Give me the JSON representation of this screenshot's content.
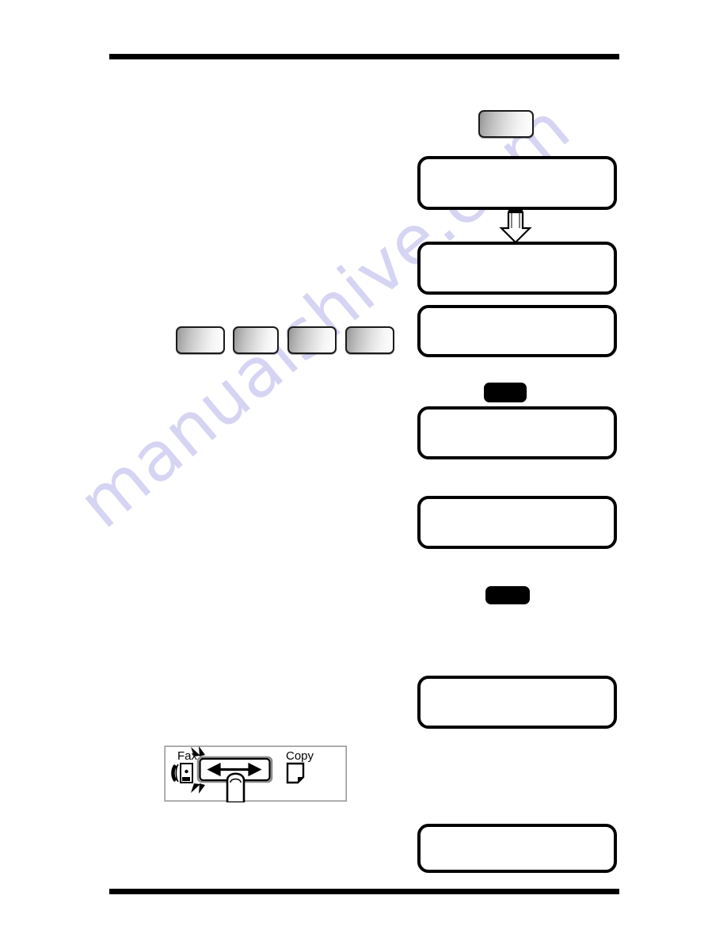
{
  "document": {
    "type": "scanned-manual-page",
    "page_background": "#ffffff",
    "rule_color": "#000000",
    "header_rule_visible": true,
    "footer_rule_visible": true,
    "header_text": "",
    "footer_text": "",
    "page_number": ""
  },
  "watermark": {
    "text": "manualshive.com",
    "color": "#c9c6ef",
    "rotation_deg": -40
  },
  "body_text": {
    "intro": "",
    "step_1": "",
    "step_2": "",
    "step_3": "",
    "step_4": "",
    "note": ""
  },
  "panel_buttons": {
    "top_right": {
      "label": "",
      "name": "function-button"
    },
    "row": [
      {
        "label": "",
        "name": "panel-button-1"
      },
      {
        "label": "",
        "name": "panel-button-2"
      },
      {
        "label": "",
        "name": "panel-button-3"
      },
      {
        "label": "",
        "name": "panel-button-4"
      }
    ]
  },
  "black_buttons": [
    {
      "label": "",
      "name": "start-button"
    },
    {
      "label": "",
      "name": "stop-button"
    }
  ],
  "lcd_displays": [
    {
      "name": "lcd-display-1",
      "line1": "",
      "line2": ""
    },
    {
      "name": "lcd-display-2",
      "line1": "",
      "line2": ""
    },
    {
      "name": "lcd-display-3",
      "line1": "",
      "line2": ""
    },
    {
      "name": "lcd-display-4",
      "line1": "",
      "line2": ""
    },
    {
      "name": "lcd-display-5",
      "line1": "",
      "line2": ""
    },
    {
      "name": "lcd-display-6",
      "line1": "",
      "line2": ""
    },
    {
      "name": "lcd-display-7",
      "line1": "",
      "line2": ""
    }
  ],
  "switch_figure": {
    "left_label": "Fax",
    "right_label": "Copy",
    "left_icon": "fax-handset-icon",
    "right_icon": "copy-page-icon",
    "slider_icon": "left-right-arrow-icon",
    "finger_icon": "finger-press-icon",
    "blink_icon": "blink-marks-icon"
  },
  "colors": {
    "ink": "#000000",
    "paper": "#ffffff",
    "watermark": "#c9c6ef",
    "button_gradient_dark": "#8f8f8f",
    "button_gradient_light": "#ffffff"
  }
}
